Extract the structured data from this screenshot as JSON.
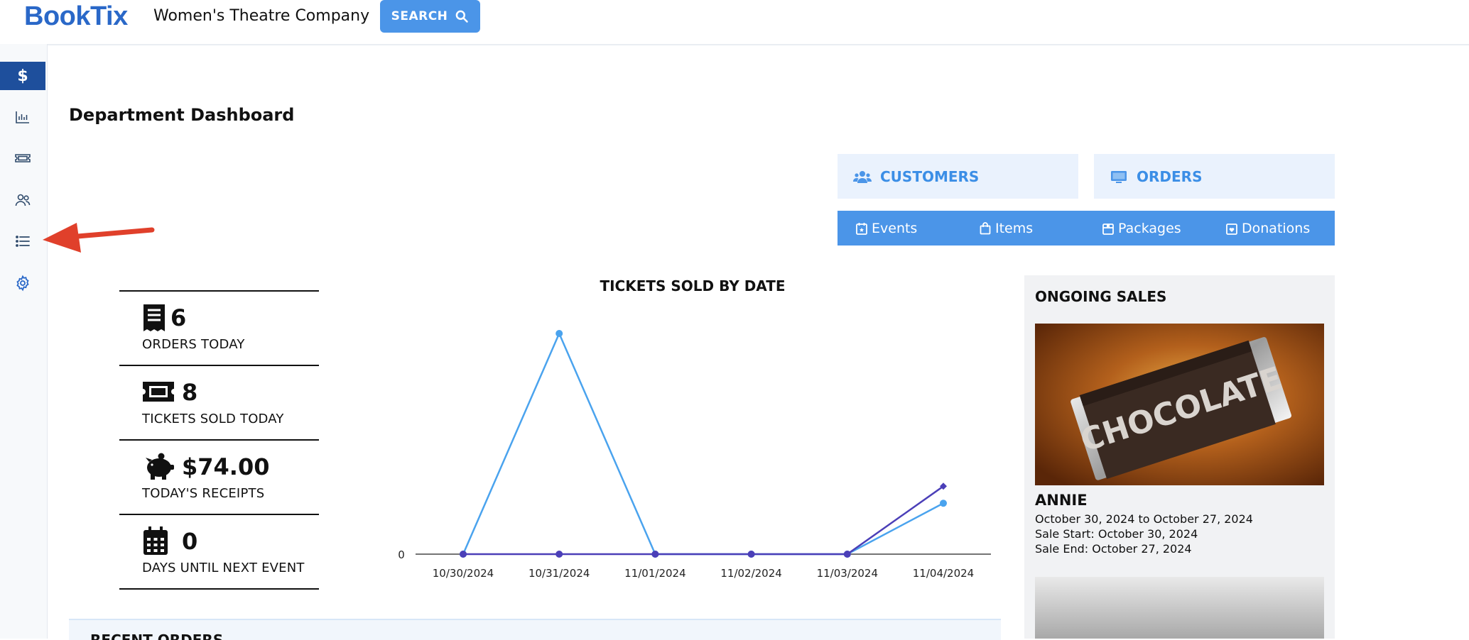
{
  "app": {
    "logo": "BookTix",
    "org_name": "Women's Theatre Company",
    "search_label": "SEARCH"
  },
  "sidebar": {
    "items": [
      {
        "icon": "dollar-icon",
        "active": true
      },
      {
        "icon": "bar-chart-icon",
        "active": false
      },
      {
        "icon": "ticket-icon",
        "active": false
      },
      {
        "icon": "users-icon",
        "active": false
      },
      {
        "icon": "list-icon",
        "active": false
      },
      {
        "icon": "gear-icon",
        "active": false
      }
    ]
  },
  "page": {
    "title": "Department Dashboard"
  },
  "quick_links": {
    "customers": "CUSTOMERS",
    "orders": "ORDERS"
  },
  "subnav": {
    "events": "Events",
    "items": "Items",
    "packages": "Packages",
    "donations": "Donations"
  },
  "stats": {
    "orders_today": {
      "value": "6",
      "label": "ORDERS TODAY"
    },
    "tickets_sold_today": {
      "value": "8",
      "label": "TICKETS SOLD TODAY"
    },
    "todays_receipts": {
      "value": "$74.00",
      "label": "TODAY'S RECEIPTS"
    },
    "days_until_next_event": {
      "value": "0",
      "label": "DAYS UNTIL NEXT EVENT"
    }
  },
  "chart_data": {
    "type": "line",
    "title": "TICKETS SOLD BY DATE",
    "x": [
      "10/30/2024",
      "10/31/2024",
      "11/01/2024",
      "11/02/2024",
      "11/03/2024",
      "11/04/2024"
    ],
    "y_tick_labels": [
      "0"
    ],
    "series": [
      {
        "color": "#4aa3ee",
        "values": [
          0,
          13,
          0,
          0,
          0,
          3
        ]
      },
      {
        "color": "#4b3fb8",
        "values": [
          0,
          0,
          0,
          0,
          0,
          4
        ]
      }
    ],
    "grid": false
  },
  "ongoing_sales": {
    "title": "ONGOING SALES",
    "item": {
      "image_text": "CHOCOLATE",
      "name": "ANNIE",
      "date_range": "October 30, 2024 to October 27, 2024",
      "sale_start": "Sale Start: October 30, 2024",
      "sale_end": "Sale End: October 27, 2024"
    }
  },
  "recent_orders": {
    "title": "RECENT ORDERS"
  },
  "colors": {
    "brand": "#2a68c8",
    "accent": "#4b95e8",
    "sidebar_active": "#1e4f9c",
    "annotation_arrow": "#e0402b"
  }
}
